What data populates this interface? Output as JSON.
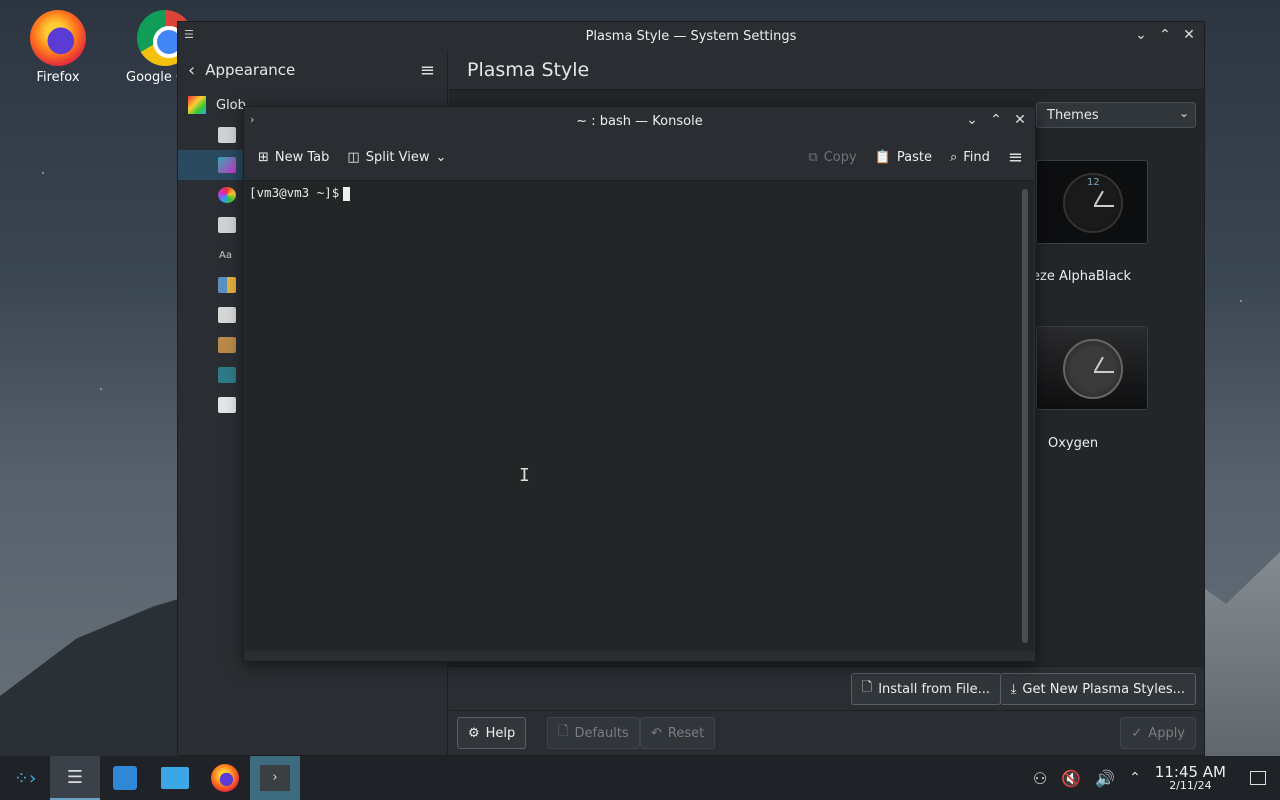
{
  "desktop": {
    "icons": [
      {
        "label": "Firefox"
      },
      {
        "label": "Google C"
      }
    ]
  },
  "settings": {
    "title": "Plasma Style — System Settings",
    "sidebar": {
      "back_label": "Appearance",
      "global_label": "Glob"
    },
    "main": {
      "title": "Plasma Style",
      "dropdown_value": "Themes",
      "themes": [
        {
          "name": "eze AlphaBlack"
        },
        {
          "name": "Oxygen"
        }
      ],
      "clock_number": "12"
    },
    "buttons": {
      "install": "Install from File...",
      "get_new": "Get New Plasma Styles...",
      "help": "Help",
      "defaults": "Defaults",
      "reset": "Reset",
      "apply": "Apply"
    }
  },
  "konsole": {
    "title": "~ : bash — Konsole",
    "toolbar": {
      "new_tab": "New Tab",
      "split_view": "Split View",
      "copy": "Copy",
      "paste": "Paste",
      "find": "Find"
    },
    "prompt": "[vm3@vm3 ~]$"
  },
  "taskbar": {
    "time": "11:45 AM",
    "date": "2/11/24"
  },
  "colors": {
    "accent": "#3d6b80",
    "selection": "#2a4a60"
  }
}
